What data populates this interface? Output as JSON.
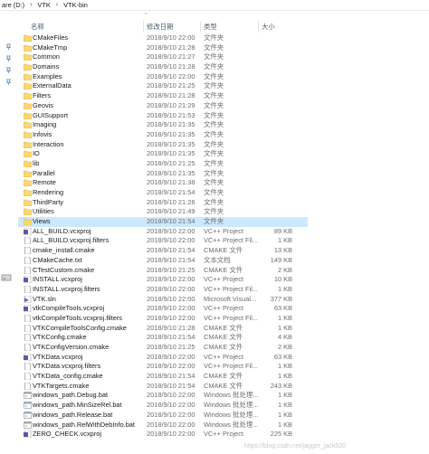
{
  "breadcrumb": [
    "are (D:)",
    "VTK",
    "VTK-bin"
  ],
  "header": {
    "name": "名称",
    "date": "修改日期",
    "type": "类型",
    "size": "大小"
  },
  "files": [
    {
      "name": "CMakeFiles",
      "date": "2018/9/10 22:00",
      "type": "文件夹",
      "size": "",
      "icon": "folder"
    },
    {
      "name": "CMakeTmp",
      "date": "2018/9/10 21:28",
      "type": "文件夹",
      "size": "",
      "icon": "folder"
    },
    {
      "name": "Common",
      "date": "2018/9/10 21:27",
      "type": "文件夹",
      "size": "",
      "icon": "folder"
    },
    {
      "name": "Domains",
      "date": "2018/9/10 21:28",
      "type": "文件夹",
      "size": "",
      "icon": "folder"
    },
    {
      "name": "Examples",
      "date": "2018/9/10 22:00",
      "type": "文件夹",
      "size": "",
      "icon": "folder"
    },
    {
      "name": "ExternalData",
      "date": "2018/9/10 21:25",
      "type": "文件夹",
      "size": "",
      "icon": "folder"
    },
    {
      "name": "Filters",
      "date": "2018/9/10 21:28",
      "type": "文件夹",
      "size": "",
      "icon": "folder"
    },
    {
      "name": "Geovis",
      "date": "2018/9/10 21:29",
      "type": "文件夹",
      "size": "",
      "icon": "folder"
    },
    {
      "name": "GUISupport",
      "date": "2018/9/10 21:53",
      "type": "文件夹",
      "size": "",
      "icon": "folder"
    },
    {
      "name": "Imaging",
      "date": "2018/9/10 21:35",
      "type": "文件夹",
      "size": "",
      "icon": "folder"
    },
    {
      "name": "Infovis",
      "date": "2018/9/10 21:35",
      "type": "文件夹",
      "size": "",
      "icon": "folder"
    },
    {
      "name": "Interaction",
      "date": "2018/9/10 21:35",
      "type": "文件夹",
      "size": "",
      "icon": "folder"
    },
    {
      "name": "IO",
      "date": "2018/9/10 21:35",
      "type": "文件夹",
      "size": "",
      "icon": "folder"
    },
    {
      "name": "lib",
      "date": "2018/9/10 21:25",
      "type": "文件夹",
      "size": "",
      "icon": "folder"
    },
    {
      "name": "Parallel",
      "date": "2018/9/10 21:35",
      "type": "文件夹",
      "size": "",
      "icon": "folder"
    },
    {
      "name": "Remote",
      "date": "2018/9/10 21:38",
      "type": "文件夹",
      "size": "",
      "icon": "folder"
    },
    {
      "name": "Rendering",
      "date": "2018/9/10 21:54",
      "type": "文件夹",
      "size": "",
      "icon": "folder"
    },
    {
      "name": "ThirdParty",
      "date": "2018/9/10 21:28",
      "type": "文件夹",
      "size": "",
      "icon": "folder"
    },
    {
      "name": "Utilities",
      "date": "2018/9/10 21:49",
      "type": "文件夹",
      "size": "",
      "icon": "folder"
    },
    {
      "name": "Views",
      "date": "2018/9/10 21:54",
      "type": "文件夹",
      "size": "",
      "icon": "folder",
      "selected": true
    },
    {
      "name": "ALL_BUILD.vcxproj",
      "date": "2018/9/10 22:00",
      "type": "VC++ Project",
      "size": "89 KB",
      "icon": "vcxproj"
    },
    {
      "name": "ALL_BUILD.vcxproj.filters",
      "date": "2018/9/10 22:00",
      "type": "VC++ Project Fil...",
      "size": "1 KB",
      "icon": "doc"
    },
    {
      "name": "cmake_install.cmake",
      "date": "2018/9/10 21:54",
      "type": "CMAKE 文件",
      "size": "13 KB",
      "icon": "doc"
    },
    {
      "name": "CMakeCache.txt",
      "date": "2018/9/10 21:54",
      "type": "文本文档",
      "size": "149 KB",
      "icon": "doc"
    },
    {
      "name": "CTestCustom.cmake",
      "date": "2018/9/10 21:25",
      "type": "CMAKE 文件",
      "size": "2 KB",
      "icon": "doc"
    },
    {
      "name": "INSTALL.vcxproj",
      "date": "2018/9/10 22:00",
      "type": "VC++ Project",
      "size": "10 KB",
      "icon": "vcxproj"
    },
    {
      "name": "INSTALL.vcxproj.filters",
      "date": "2018/9/10 22:00",
      "type": "VC++ Project Fil...",
      "size": "1 KB",
      "icon": "doc"
    },
    {
      "name": "VTK.sln",
      "date": "2018/9/10 22:00",
      "type": "Microsoft Visual...",
      "size": "377 KB",
      "icon": "sln"
    },
    {
      "name": "vtkCompileTools.vcxproj",
      "date": "2018/9/10 22:00",
      "type": "VC++ Project",
      "size": "63 KB",
      "icon": "vcxproj"
    },
    {
      "name": "vtkCompileTools.vcxproj.filters",
      "date": "2018/9/10 22:00",
      "type": "VC++ Project Fil...",
      "size": "1 KB",
      "icon": "doc"
    },
    {
      "name": "VTKCompileToolsConfig.cmake",
      "date": "2018/9/10 21:28",
      "type": "CMAKE 文件",
      "size": "1 KB",
      "icon": "doc"
    },
    {
      "name": "VTKConfig.cmake",
      "date": "2018/9/10 21:54",
      "type": "CMAKE 文件",
      "size": "4 KB",
      "icon": "doc"
    },
    {
      "name": "VTKConfigVersion.cmake",
      "date": "2018/9/10 21:25",
      "type": "CMAKE 文件",
      "size": "2 KB",
      "icon": "doc"
    },
    {
      "name": "VTKData.vcxproj",
      "date": "2018/9/10 22:00",
      "type": "VC++ Project",
      "size": "63 KB",
      "icon": "vcxproj"
    },
    {
      "name": "VTKData.vcxproj.filters",
      "date": "2018/9/10 22:00",
      "type": "VC++ Project Fil...",
      "size": "1 KB",
      "icon": "doc"
    },
    {
      "name": "VTKData_config.cmake",
      "date": "2018/9/10 21:54",
      "type": "CMAKE 文件",
      "size": "1 KB",
      "icon": "doc"
    },
    {
      "name": "VTKTargets.cmake",
      "date": "2018/9/10 21:54",
      "type": "CMAKE 文件",
      "size": "243 KB",
      "icon": "doc"
    },
    {
      "name": "windows_path.Debug.bat",
      "date": "2018/9/10 22:00",
      "type": "Windows 批处理...",
      "size": "1 KB",
      "icon": "bat"
    },
    {
      "name": "windows_path.MinSizeRel.bat",
      "date": "2018/9/10 22:00",
      "type": "Windows 批处理...",
      "size": "1 KB",
      "icon": "bat"
    },
    {
      "name": "windows_path.Release.bat",
      "date": "2018/9/10 22:00",
      "type": "Windows 批处理...",
      "size": "1 KB",
      "icon": "bat"
    },
    {
      "name": "windows_path.RelWithDebInfo.bat",
      "date": "2018/9/10 22:00",
      "type": "Windows 批处理...",
      "size": "1 KB",
      "icon": "bat"
    },
    {
      "name": "ZERO_CHECK.vcxproj",
      "date": "2018/9/10 22:00",
      "type": "VC++ Project",
      "size": "225 KB",
      "icon": "vcxproj"
    }
  ],
  "watermark": "https://blog.csdn.net/jagger_jack520",
  "colors": {
    "folder": "#f8d775",
    "selected": "#cce8ff",
    "vcxproj": "#6c4fa3",
    "sln": "#7a5bb5",
    "header_text": "#4c607a"
  }
}
